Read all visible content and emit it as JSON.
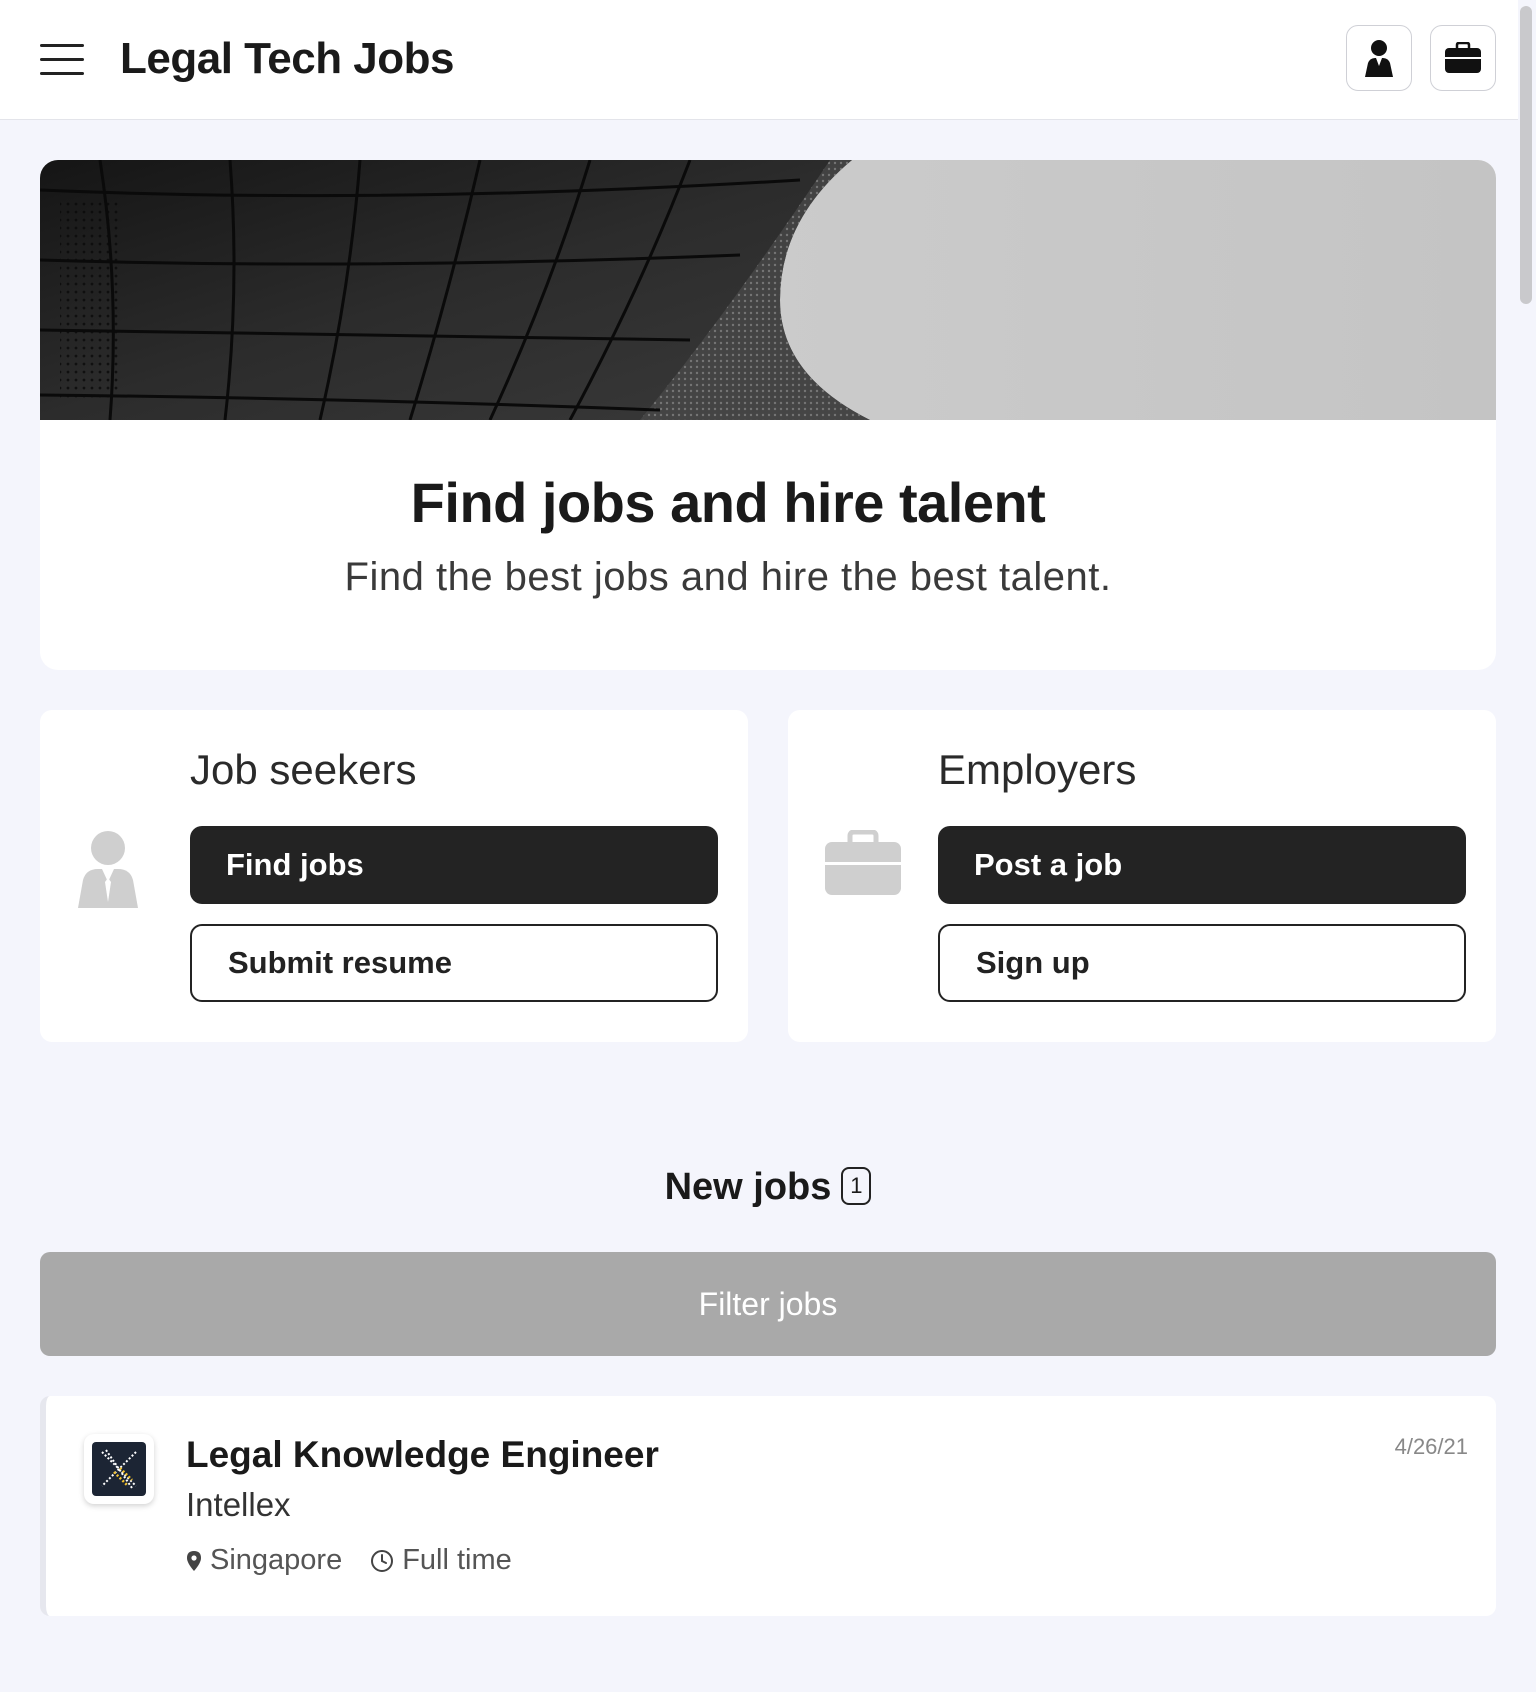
{
  "header": {
    "title": "Legal Tech Jobs",
    "menu_icon": "hamburger-menu-icon",
    "seeker_icon": "person-icon",
    "employer_icon": "briefcase-icon"
  },
  "hero": {
    "title": "Find jobs and hire talent",
    "subtitle": "Find the best jobs and hire the best talent."
  },
  "seekers": {
    "heading": "Job seekers",
    "primary_label": "Find jobs",
    "secondary_label": "Submit resume",
    "icon": "person-icon"
  },
  "employers": {
    "heading": "Employers",
    "primary_label": "Post a job",
    "secondary_label": "Sign up",
    "icon": "briefcase-icon"
  },
  "jobs_section": {
    "heading": "New jobs",
    "count": "1",
    "filter_label": "Filter jobs"
  },
  "jobs": [
    {
      "title": "Legal Knowledge Engineer",
      "company": "Intellex",
      "location": "Singapore",
      "type": "Full time",
      "date": "4/26/21"
    }
  ],
  "colors": {
    "background": "#f4f5fc",
    "primary_button": "#232323",
    "filter_button": "#a9a9a9"
  }
}
